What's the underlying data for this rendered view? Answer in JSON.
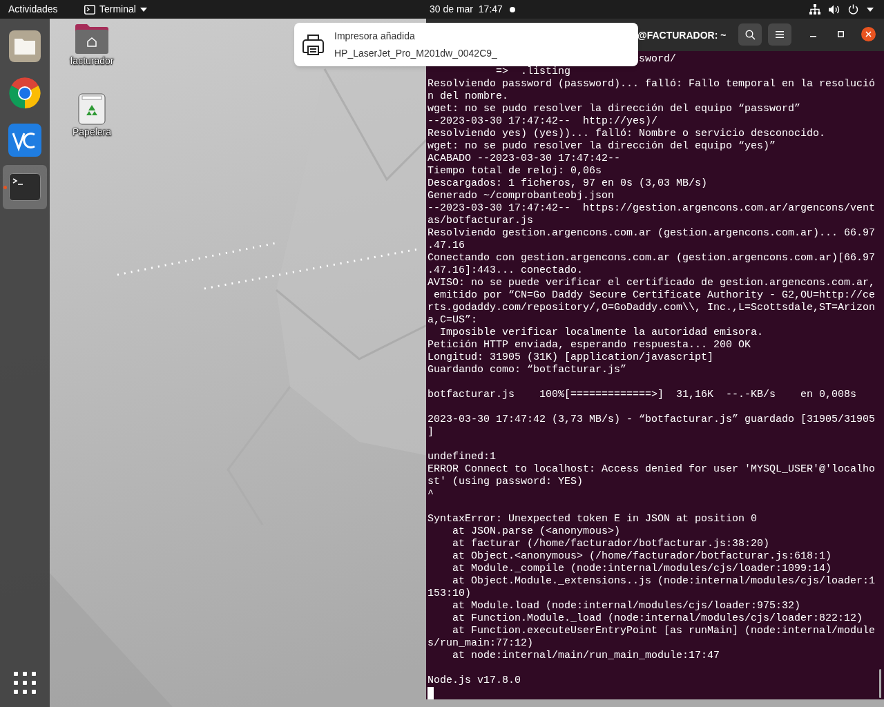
{
  "top_bar": {
    "activities": "Actividades",
    "app_menu": "Terminal",
    "clock": "30 de mar  17:47",
    "has_notification": true
  },
  "dock": {
    "items": [
      {
        "kind": "files",
        "running": false
      },
      {
        "kind": "browser",
        "running": false
      },
      {
        "kind": "vnc",
        "running": false
      },
      {
        "kind": "terminal",
        "running": true
      }
    ]
  },
  "desktop_icons": [
    {
      "kind": "home-folder",
      "label": "facturador"
    },
    {
      "kind": "trash",
      "label": "Papelera"
    }
  ],
  "notification": {
    "title": "Impresora añadida",
    "body": "HP_LaserJet_Pro_M201dw_0042C9_"
  },
  "terminal": {
    "title": "@FACTURADOR: ~",
    "partial_line": "sword/",
    "blocks": [
      [
        "           =>  .listing",
        "Resolviendo password (password)... falló: Fallo temporal en la resolució",
        "n del nombre.",
        "wget: no se pudo resolver la dirección del equipo “password”",
        "--2023-03-30 17:47:42--  http://yes)/",
        "Resolviendo yes) (yes))... falló: Nombre o servicio desconocido.",
        "wget: no se pudo resolver la dirección del equipo “yes)”",
        "ACABADO --2023-03-30 17:47:42--",
        "Tiempo total de reloj: 0,06s",
        "Descargados: 1 ficheros, 97 en 0s (3,03 MB/s)",
        "Generado ~/comprobanteobj.json",
        "--2023-03-30 17:47:42--  https://gestion.argencons.com.ar/argencons/vent",
        "as/botfacturar.js",
        "Resolviendo gestion.argencons.com.ar (gestion.argencons.com.ar)... 66.97",
        ".47.16",
        "Conectando con gestion.argencons.com.ar (gestion.argencons.com.ar)[66.97",
        ".47.16]:443... conectado.",
        "AVISO: no se puede verificar el certificado de gestion.argencons.com.ar,",
        " emitido por “CN=Go Daddy Secure Certificate Authority - G2,OU=http://ce",
        "rts.godaddy.com/repository/,O=GoDaddy.com\\\\, Inc.,L=Scottsdale,ST=Arizon",
        "a,C=US”:",
        "  Imposible verificar localmente la autoridad emisora.",
        "Petición HTTP enviada, esperando respuesta... 200 OK",
        "Longitud: 31905 (31K) [application/javascript]",
        "Guardando como: “botfacturar.js”"
      ],
      [
        "botfacturar.js    100%[=============>]  31,16K  --.-KB/s    en 0,008s"
      ],
      [
        "2023-03-30 17:47:42 (3,73 MB/s) - “botfacturar.js” guardado [31905/31905",
        "]"
      ],
      [
        "undefined:1",
        "ERROR Connect to localhost: Access denied for user 'MYSQL_USER'@'localho",
        "st' (using password: YES)",
        "^"
      ],
      [
        "SyntaxError: Unexpected token E in JSON at position 0",
        "    at JSON.parse (<anonymous>)",
        "    at facturar (/home/facturador/botfacturar.js:38:20)",
        "    at Object.<anonymous> (/home/facturador/botfacturar.js:618:1)",
        "    at Module._compile (node:internal/modules/cjs/loader:1099:14)",
        "    at Object.Module._extensions..js (node:internal/modules/cjs/loader:1",
        "153:10)",
        "    at Module.load (node:internal/modules/cjs/loader:975:32)",
        "    at Function.Module._load (node:internal/modules/cjs/loader:822:12)",
        "    at Function.executeUserEntryPoint [as runMain] (node:internal/module",
        "s/run_main:77:12)",
        "    at node:internal/main/run_main_module:17:47"
      ],
      [
        "Node.js v17.8.0"
      ]
    ]
  }
}
